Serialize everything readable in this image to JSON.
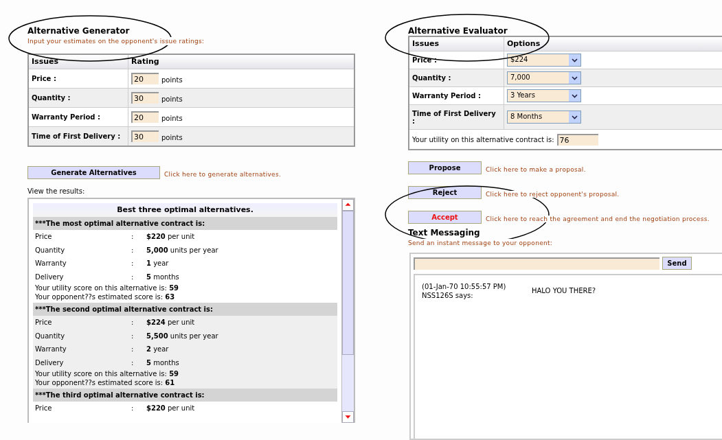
{
  "generator": {
    "title": "Alternative Generator",
    "subtitle": "Input your estimates on the opponent's issue ratings:",
    "columns": [
      "Issues",
      "Rating"
    ],
    "rows": [
      {
        "issue": "Price :",
        "value": "20",
        "unit": "points"
      },
      {
        "issue": "Quantity :",
        "value": "30",
        "unit": "points"
      },
      {
        "issue": "Warranty Period :",
        "value": "20",
        "unit": "points"
      },
      {
        "issue": "Time of First Delivery :",
        "value": "30",
        "unit": "points"
      }
    ],
    "button": "Generate Alternatives",
    "hint": "Click here to generate alternatives."
  },
  "results": {
    "label": "View the results:",
    "heading": "Best three optimal alternatives.",
    "contracts": [
      {
        "title": "***The most optimal alternative contract is:",
        "lines": [
          {
            "name": "Price",
            "sep": ":",
            "value": "**$220** per unit"
          },
          {
            "name": "Quantity",
            "sep": ":",
            "value": "**5,000** units per year"
          },
          {
            "name": "Warranty",
            "sep": ":",
            "value": "**1** year"
          },
          {
            "name": "Delivery",
            "sep": ":",
            "value": "**5** months"
          }
        ],
        "scores": [
          "Your utility score on this alternative is: **59**",
          "Your opponent??s estimated score is: **63**"
        ]
      },
      {
        "title": "***The second optimal alternative contract is:",
        "lines": [
          {
            "name": "Price",
            "sep": ":",
            "value": "**$224** per unit"
          },
          {
            "name": "Quantity",
            "sep": ":",
            "value": "**5,500** units per year"
          },
          {
            "name": "Warranty",
            "sep": ":",
            "value": "**2** year"
          },
          {
            "name": "Delivery",
            "sep": ":",
            "value": "**5** months"
          }
        ],
        "scores": [
          "Your utility score on this alternative is: **59**",
          "Your opponent??s estimated score is: **61**"
        ]
      },
      {
        "title": "***The third optimal alternative contract is:",
        "lines": [
          {
            "name": "Price",
            "sep": ":",
            "value": "**$220** per unit"
          }
        ]
      }
    ]
  },
  "evaluator": {
    "title": "Alternative Evaluator",
    "columns": [
      "Issues",
      "Options"
    ],
    "rows": [
      {
        "issue": "Price :",
        "value": "$224"
      },
      {
        "issue": "Quantity :",
        "value": "7,000"
      },
      {
        "issue": "Warranty Period :",
        "value": "3 Years"
      },
      {
        "issue": "Time of First Delivery :",
        "value": "8 Months"
      }
    ],
    "utility_label": "Your utility on this alternative contract is:",
    "utility_value": "76"
  },
  "actions": [
    {
      "label": "Propose",
      "hint": "Click here to make a proposal.",
      "kind": "normal"
    },
    {
      "label": "Reject",
      "hint": "Click here to reject opponent's proposal.",
      "kind": "normal"
    },
    {
      "label": "Accept",
      "hint": "Click here to reach the agreement and end the negotiation process.",
      "kind": "alert"
    }
  ],
  "messaging": {
    "title": "Text Messaging",
    "subtitle": "Send an instant message to your opponent:",
    "send": "Send",
    "messages": [
      {
        "time": "(01-Jan-70 10:55:57 PM)",
        "sender": "NSS126S says:",
        "text": "HALO YOU THERE?"
      }
    ]
  }
}
